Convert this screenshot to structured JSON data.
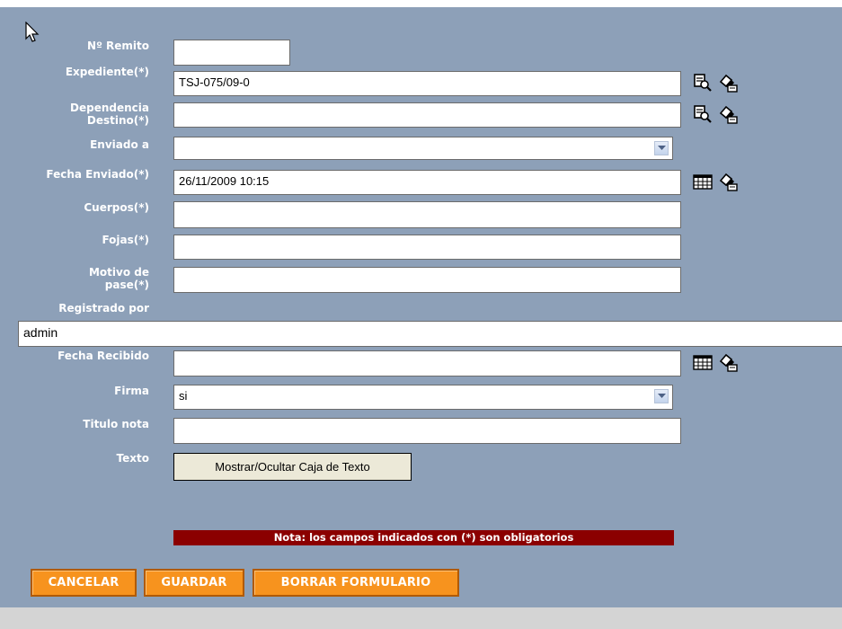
{
  "form": {
    "fields": {
      "nro_remito": {
        "label": "Nº Remito",
        "value": ""
      },
      "expediente": {
        "label": "Expediente(*)",
        "value": "TSJ-075/09-0"
      },
      "dependencia": {
        "label": "Dependencia\nDestino(*)",
        "value": ""
      },
      "enviado_a": {
        "label": "Enviado a",
        "value": ""
      },
      "fecha_enviado": {
        "label": "Fecha Enviado(*)",
        "value": "26/11/2009 10:15"
      },
      "cuerpos": {
        "label": "Cuerpos(*)",
        "value": ""
      },
      "fojas": {
        "label": "Fojas(*)",
        "value": ""
      },
      "motivo": {
        "label": "Motivo de\npase(*)",
        "value": ""
      },
      "registrado": {
        "label": "Registrado por",
        "value": "admin"
      },
      "fecha_recibido": {
        "label": "Fecha Recibido",
        "value": ""
      },
      "firma": {
        "label": "Firma",
        "value": "si"
      },
      "titulo_nota": {
        "label": "Titulo nota",
        "value": ""
      },
      "texto": {
        "label": "Texto",
        "button": "Mostrar/Ocultar Caja de Texto"
      }
    },
    "note": "Nota: los campos indicados con (*) son obligatorios",
    "buttons": {
      "cancel": "CANCELAR",
      "save": "GUARDAR",
      "clear": "BORRAR FORMULARIO"
    }
  },
  "icons": [
    "search-icon",
    "eraser-icon",
    "calendar-icon"
  ],
  "colors": {
    "panel": "#8da0b8",
    "note_bg": "#8b0000",
    "button_orange": "#f7931e"
  }
}
